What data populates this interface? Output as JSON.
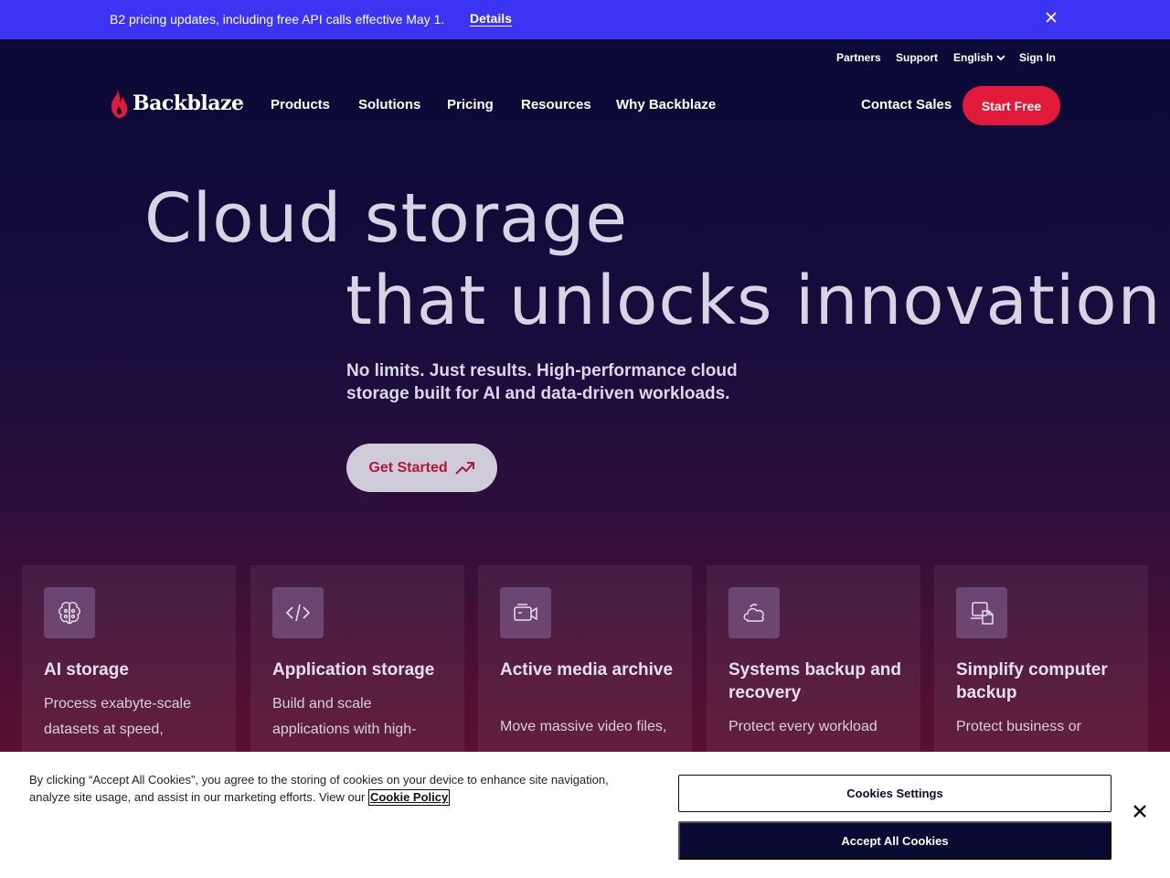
{
  "banner": {
    "text": "B2 pricing updates, including free API calls effective May 1.",
    "link": "Details",
    "close_icon": "close-icon"
  },
  "utility_nav": {
    "partners": "Partners",
    "support": "Support",
    "language": "English",
    "sign_in": "Sign In"
  },
  "nav": {
    "logo": "Backblaze",
    "items": [
      "Products",
      "Solutions",
      "Pricing",
      "Resources",
      "Why Backblaze"
    ],
    "contact": "Contact Sales",
    "start": "Start Free"
  },
  "hero": {
    "line1": "Cloud storage",
    "line2": "that unlocks innovation",
    "subtitle": "No limits. Just results. High-performance cloud storage built for AI and data-driven workloads.",
    "cta": "Get Started"
  },
  "cards": [
    {
      "icon": "brain-icon",
      "title": "AI storage",
      "desc": "Process exabyte-scale datasets at speed,"
    },
    {
      "icon": "code-icon",
      "title": "Application storage",
      "desc": "Build and scale applications with high-"
    },
    {
      "icon": "video-camera-icon",
      "title": "Active media archive",
      "desc": "Move massive video files,"
    },
    {
      "icon": "cloud-icon",
      "title": "Systems backup and recovery",
      "desc": "Protect every workload"
    },
    {
      "icon": "device-document-icon",
      "title": "Simplify computer backup",
      "desc": "Protect business or"
    }
  ],
  "cookie": {
    "text": "By clicking “Accept All Cookies”, you agree to the storing of cookies on your device to enhance site navigation, analyze site usage, and assist in our marketing efforts. View our",
    "policy_link": "Cookie Policy",
    "settings": "Cookies Settings",
    "accept": "Accept All Cookies"
  },
  "colors": {
    "banner": "#3b34f2",
    "accent_red": "#e21a3a",
    "navy": "#0b0a33"
  }
}
